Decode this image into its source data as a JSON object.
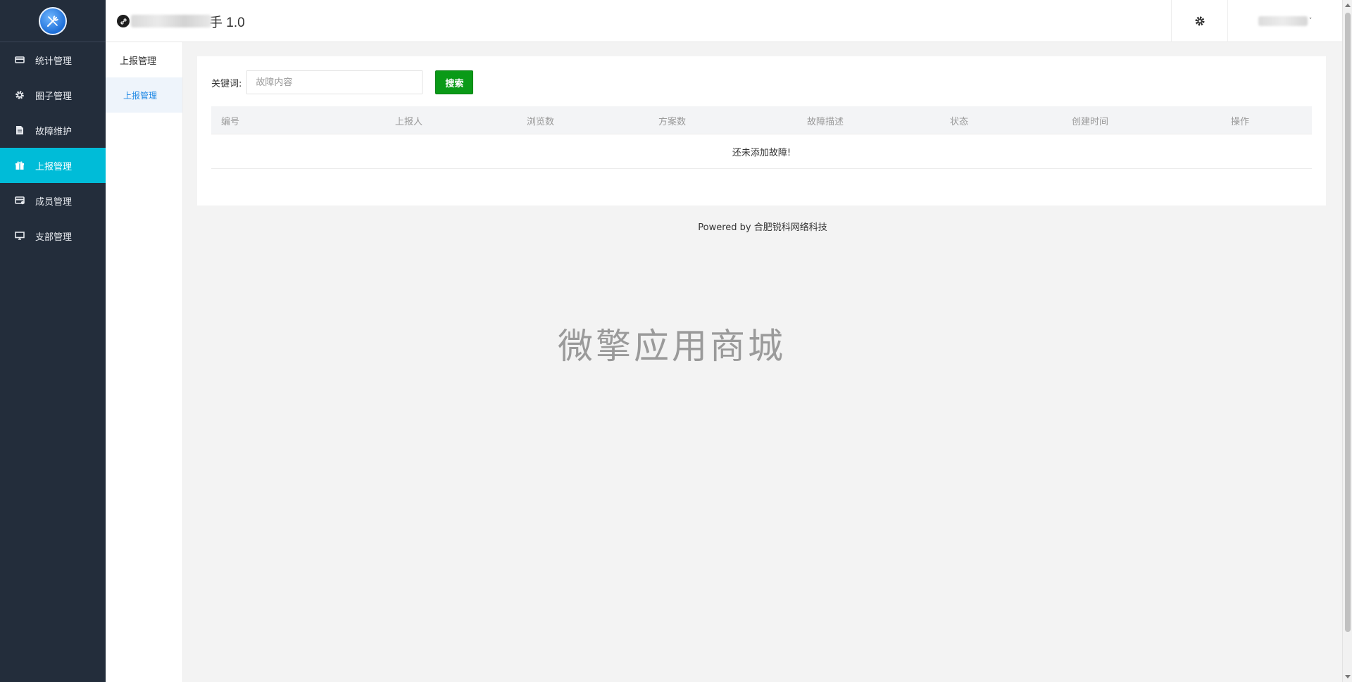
{
  "sidebar": {
    "items": [
      {
        "label": "统计管理",
        "icon": "stats-icon",
        "active": false
      },
      {
        "label": "圈子管理",
        "icon": "gear-icon",
        "active": false
      },
      {
        "label": "故障维护",
        "icon": "document-icon",
        "active": false
      },
      {
        "label": "上报管理",
        "icon": "gift-icon",
        "active": true
      },
      {
        "label": "成员管理",
        "icon": "members-icon",
        "active": false
      },
      {
        "label": "支部管理",
        "icon": "monitor-icon",
        "active": false
      }
    ]
  },
  "header": {
    "title_visible": "手 1.0",
    "settings_icon": "gear-icon",
    "user_caret": "˅"
  },
  "submenu": {
    "title": "上报管理",
    "items": [
      {
        "label": "上报管理",
        "active": true
      }
    ]
  },
  "search": {
    "label": "关键词:",
    "placeholder": "故障内容",
    "value": "",
    "button": "搜索"
  },
  "table": {
    "columns": [
      "编号",
      "上报人",
      "浏览数",
      "方案数",
      "故障描述",
      "状态",
      "创建时间",
      "操作"
    ],
    "empty_text": "还未添加故障!"
  },
  "footer": {
    "text": "Powered by 合肥锐科网络科技"
  },
  "watermark": "微擎应用商城",
  "colors": {
    "sidebar_bg": "#232d3b",
    "active_nav": "#00bcd8",
    "search_button": "#0a9a17",
    "submenu_active_text": "#1e88e5"
  }
}
